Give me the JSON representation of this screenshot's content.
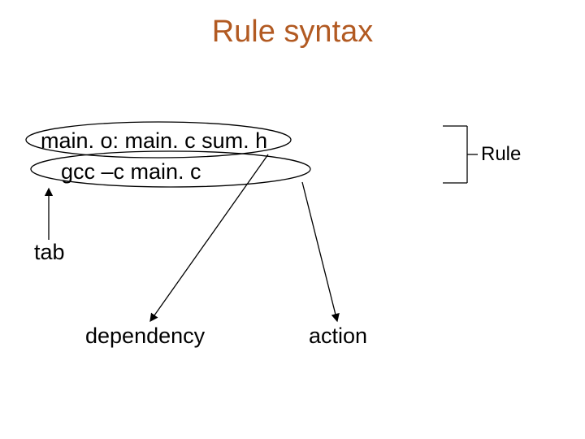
{
  "title": "Rule syntax",
  "code": {
    "line1": "main. o: main. c sum. h",
    "line2": "gcc –c main. c"
  },
  "labels": {
    "rule": "Rule",
    "tab": "tab",
    "dependency": "dependency",
    "action": "action"
  }
}
